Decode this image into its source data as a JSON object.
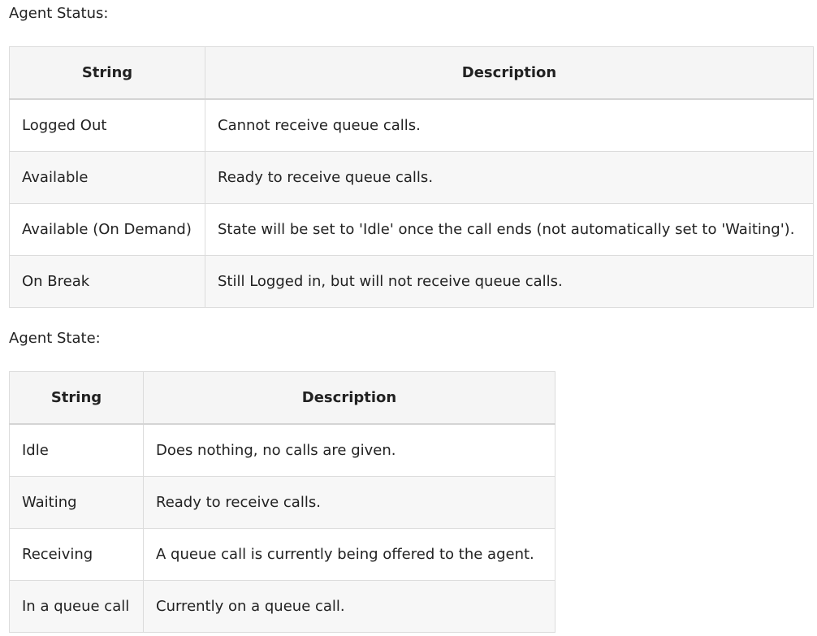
{
  "agent_status": {
    "label": "Agent Status:",
    "headers": {
      "string": "String",
      "description": "Description"
    },
    "rows": [
      {
        "string": "Logged Out",
        "description": "Cannot receive queue calls."
      },
      {
        "string": "Available",
        "description": "Ready to receive queue calls."
      },
      {
        "string": "Available (On Demand)",
        "description": "State will be set to 'Idle' once the call ends (not automatically set to 'Waiting')."
      },
      {
        "string": "On Break",
        "description": "Still Logged in, but will not receive queue calls."
      }
    ]
  },
  "agent_state": {
    "label": "Agent State:",
    "headers": {
      "string": "String",
      "description": "Description"
    },
    "rows": [
      {
        "string": "Idle",
        "description": "Does nothing, no calls are given."
      },
      {
        "string": "Waiting",
        "description": "Ready to receive calls."
      },
      {
        "string": "Receiving",
        "description": "A queue call is currently being offered to the agent."
      },
      {
        "string": "In a queue call",
        "description": "Currently on a queue call."
      }
    ]
  }
}
